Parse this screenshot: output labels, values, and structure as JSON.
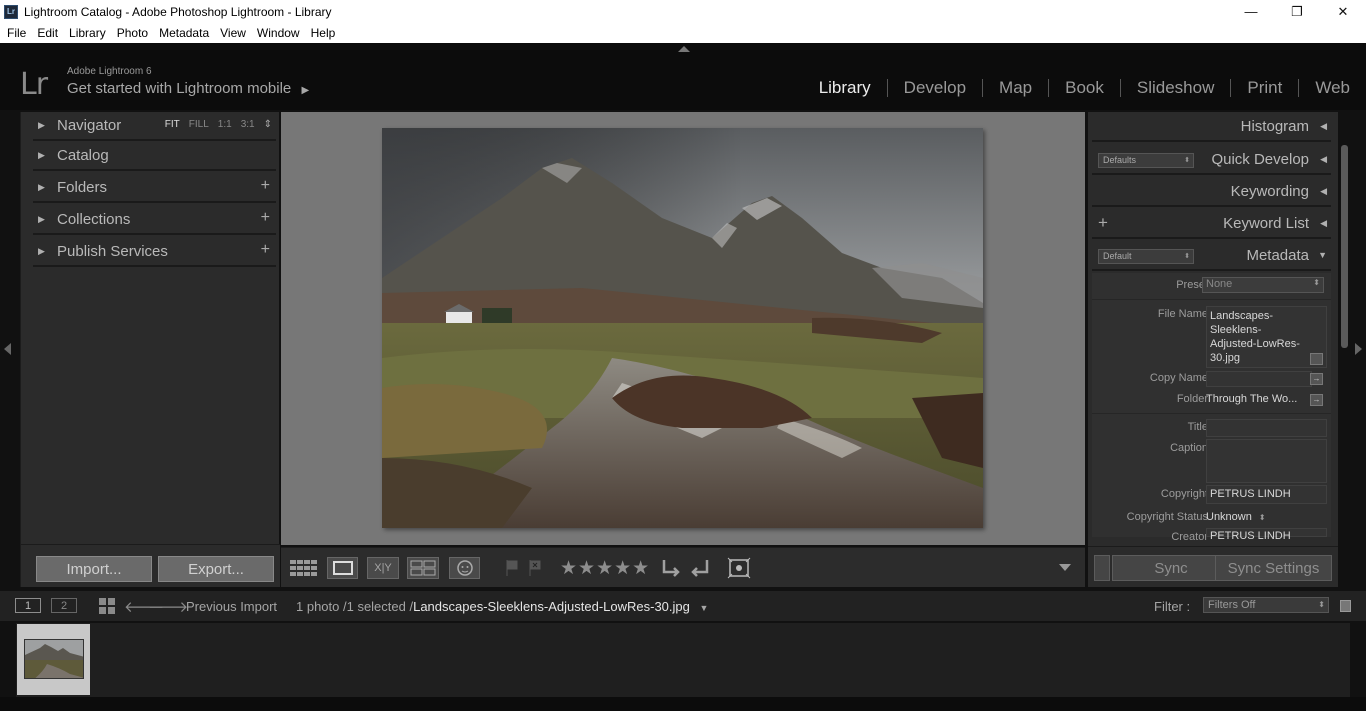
{
  "window": {
    "title": "Lightroom Catalog - Adobe Photoshop Lightroom - Library",
    "app_icon": "Lr",
    "controls": [
      "—",
      "❐",
      "✕"
    ]
  },
  "menu": [
    "File",
    "Edit",
    "Library",
    "Photo",
    "Metadata",
    "View",
    "Window",
    "Help"
  ],
  "identity": {
    "logo": "Lr",
    "version": "Adobe Lightroom 6",
    "mobile_prompt": "Get started with Lightroom mobile",
    "mobile_arrow": "▶"
  },
  "modules": {
    "library": "Library",
    "develop": "Develop",
    "map": "Map",
    "book": "Book",
    "slideshow": "Slideshow",
    "print": "Print",
    "web": "Web",
    "active": "Library"
  },
  "left_panel": {
    "navigator": {
      "label": "Navigator",
      "fit": "FIT",
      "fill": "FILL",
      "one": "1:1",
      "three": "3:1",
      "arrows": "⇕"
    },
    "catalog": "Catalog",
    "folders": "Folders",
    "collections": "Collections",
    "publish": "Publish Services",
    "plus": "+",
    "import": "Import...",
    "export": "Export..."
  },
  "right_panel": {
    "histogram": "Histogram",
    "quick_develop": "Quick Develop",
    "quick_develop_preset": "Defaults",
    "keywording": "Keywording",
    "keyword_list": "Keyword List",
    "metadata": "Metadata",
    "metadata_preset": "Default",
    "preset_label": "Preset",
    "preset_value": "None",
    "file_name_label": "File Name",
    "file_name_lines": [
      "Landscapes-",
      "Sleeklens-",
      "Adjusted-LowRes-",
      "30.jpg"
    ],
    "copy_name_label": "Copy Name",
    "folder_label": "Folder",
    "folder_value": "Through The Wo...",
    "title_label": "Title",
    "caption_label": "Caption",
    "copyright_label": "Copyright",
    "copyright_value": "PETRUS LINDH",
    "copyright_status_label": "Copyright Status",
    "copyright_status_value": "Unknown",
    "creator_label": "Creator",
    "creator_value": "PETRUS LINDH",
    "sync": "Sync",
    "sync_settings": "Sync Settings"
  },
  "toolbar": {
    "stars": "★★★★★"
  },
  "filmstrip_bar": {
    "screen1": "1",
    "screen2": "2",
    "source": "Previous Import",
    "count": "1 photo /1 selected /",
    "filename": "Landscapes-Sleeklens-Adjusted-LowRes-30.jpg",
    "filter_label": "Filter :",
    "filter_value": "Filters Off"
  },
  "colors": {
    "panel": "#2b2b2b",
    "background": "#777777",
    "text": "#b9b9b9",
    "active_module": "#ececec"
  }
}
